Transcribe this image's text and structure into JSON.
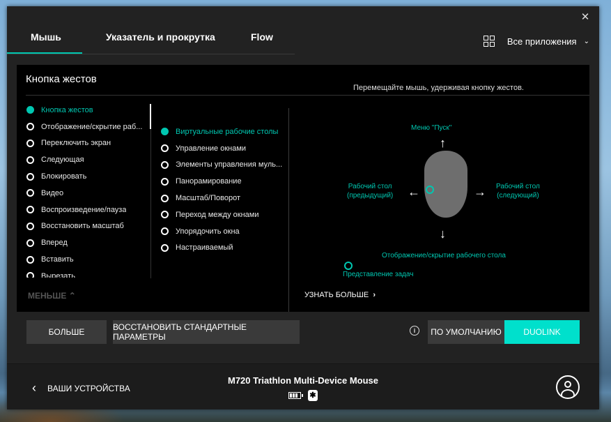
{
  "window": {
    "close_glyph": "✕"
  },
  "tabs": [
    {
      "label": "Мышь",
      "active": true
    },
    {
      "label": "Указатель и прокрутка"
    },
    {
      "label": "Flow"
    }
  ],
  "apps": {
    "label": "Все приложения",
    "icon": "grid-icon",
    "chevron": "⌄"
  },
  "panel": {
    "title": "Кнопка жестов",
    "hint": "Перемещайте мышь, удерживая кнопку жестов.",
    "actions": [
      {
        "label": "Кнопка жестов",
        "active": true
      },
      {
        "label": "Отображение/скрытие раб..."
      },
      {
        "label": "Переключить экран"
      },
      {
        "label": "Следующая"
      },
      {
        "label": "Блокировать"
      },
      {
        "label": "Видео"
      },
      {
        "label": "Воспроизведение/пауза"
      },
      {
        "label": "Восстановить масштаб"
      },
      {
        "label": "Вперед"
      },
      {
        "label": "Вставить"
      },
      {
        "label": "Вырезать"
      }
    ],
    "gestures": [
      {
        "label": "Виртуальные рабочие столы",
        "active": true
      },
      {
        "label": "Управление окнами"
      },
      {
        "label": "Элементы управления муль..."
      },
      {
        "label": "Панорамирование"
      },
      {
        "label": "Масштаб/Поворот"
      },
      {
        "label": "Переход между окнами"
      },
      {
        "label": "Упорядочить окна"
      },
      {
        "label": "Настраиваемый"
      }
    ],
    "less_label": "МЕНЬШЕ",
    "learn_more_label": "УЗНАТЬ БОЛЬШЕ",
    "diagram": {
      "up_label": "Меню \"Пуск\"",
      "left_label_1": "Рабочий стол",
      "left_label_2": "(предыдущий)",
      "right_label_1": "Рабочий стол",
      "right_label_2": "(следующий)",
      "down_label": "Отображение/скрытие рабочего стола",
      "tap_label": "Представление задач",
      "accent": "#00c7b1"
    }
  },
  "buttons": {
    "more": "БОЛЬШЕ",
    "restore": "ВОССТАНОВИТЬ СТАНДАРТНЫЕ ПАРАМЕТРЫ",
    "info": "i",
    "default": "ПО УМОЛЧАНИЮ",
    "duolink": "DUOLINK"
  },
  "footer": {
    "back_label": "ВАШИ УСТРОЙСТВА",
    "device_name": "M720 Triathlon Multi-Device Mouse",
    "bluetooth_glyph": "✱"
  }
}
